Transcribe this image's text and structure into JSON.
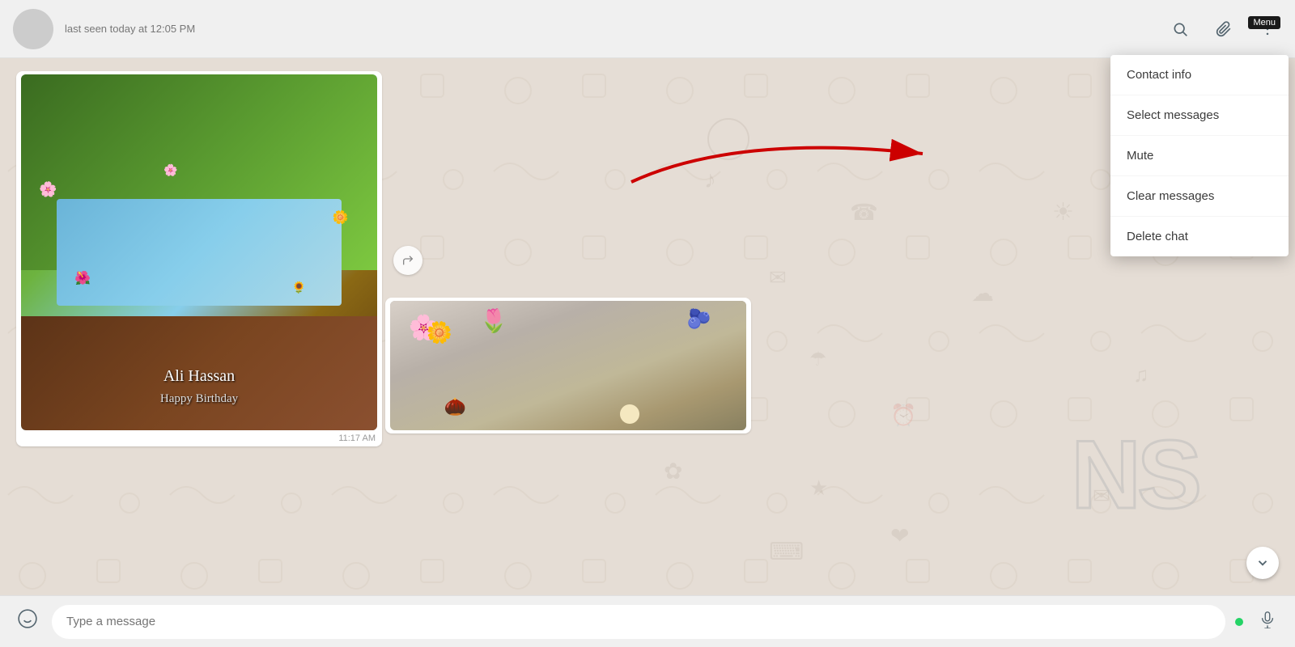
{
  "header": {
    "avatar_alt": "contact avatar",
    "contact_status": "last seen today at 12:05 PM",
    "search_label": "Search",
    "attach_label": "Attach",
    "menu_label": "Menu",
    "menu_tooltip": "Menu"
  },
  "toolbar": {
    "search_icon": "🔍",
    "attach_icon": "📎",
    "more_icon": "⋮"
  },
  "dropdown": {
    "items": [
      {
        "label": "Contact info"
      },
      {
        "label": "Select messages"
      },
      {
        "label": "Mute"
      },
      {
        "label": "Clear messages"
      },
      {
        "label": "Delete chat"
      }
    ]
  },
  "messages": [
    {
      "type": "image",
      "time": "11:17 AM",
      "alt": "Birthday cake image"
    },
    {
      "type": "image",
      "time": "",
      "alt": "Flowers image"
    }
  ],
  "input": {
    "placeholder": "Type a message"
  },
  "watermark": "NS",
  "forward_icon": "↩",
  "scroll_down_icon": "⌄"
}
